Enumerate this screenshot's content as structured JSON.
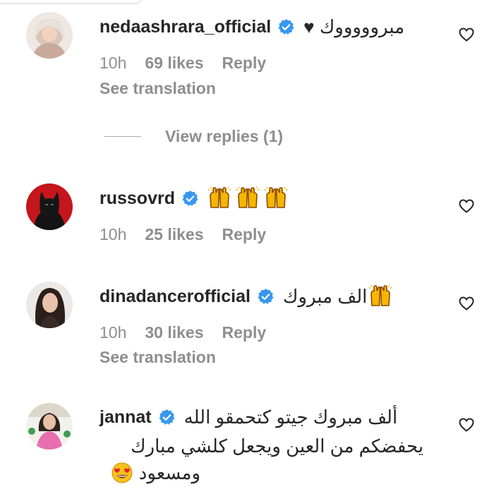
{
  "comments": [
    {
      "username": "nedaashrara_official",
      "text": "مبروووووك ♥",
      "time": "10h",
      "likes": "69 likes",
      "reply": "Reply",
      "see_translation": "See translation"
    },
    {
      "username": "russovrd",
      "text": "",
      "emoji_count": 3,
      "time": "10h",
      "likes": "25 likes",
      "reply": "Reply"
    },
    {
      "username": "dinadancerofficial",
      "text": "الف مبروك",
      "time": "10h",
      "likes": "30 likes",
      "reply": "Reply",
      "see_translation": "See translation"
    },
    {
      "username": "jannat",
      "text_line1": "ألف مبروك جيتو كتحمقو الله",
      "text_line2": "يحفضكم من العين ويجعل كلشي مبارك",
      "text_line3": "ومسعود"
    }
  ],
  "view_replies": "View replies (1)",
  "icons": {
    "verified": "verified-badge-icon",
    "like": "heart-outline-icon",
    "raising_hands": "raising-hands-emoji",
    "heart_eyes": "heart-eyes-emoji"
  },
  "colors": {
    "verified_blue": "#3897f0",
    "text": "#262626",
    "secondary": "#8e8e8e"
  }
}
